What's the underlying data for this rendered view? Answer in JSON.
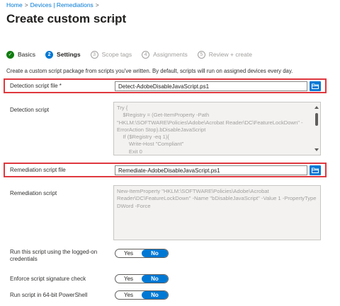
{
  "breadcrumb": {
    "items": [
      "Home",
      "Devices | Remediations"
    ]
  },
  "page": {
    "title": "Create custom script",
    "more": "···"
  },
  "wizard": {
    "steps": [
      {
        "num": "✓",
        "label": "Basics",
        "state": "done"
      },
      {
        "num": "2",
        "label": "Settings",
        "state": "active"
      },
      {
        "num": "3",
        "label": "Scope tags",
        "state": "pending"
      },
      {
        "num": "4",
        "label": "Assignments",
        "state": "pending"
      },
      {
        "num": "5",
        "label": "Review + create",
        "state": "pending"
      }
    ]
  },
  "description": "Create a custom script package from scripts you've written. By default, scripts will run on assigned devices every day.",
  "detection_file": {
    "label": "Detection script file *",
    "value": "Detect-AdobeDisableJavaScript.ps1"
  },
  "detection_script": {
    "label": "Detection script",
    "lines": [
      "Try {",
      "    $Registry = (Get-ItemProperty -Path",
      "\"HKLM:\\SOFTWARE\\Policies\\Adobe\\Acrobat Reader\\DC\\FeatureLockDown\" -",
      "ErrorAction Stop).bDisableJavaScript",
      "    If ($Registry -eq 1){",
      "        Write-Host \"Compliant\"",
      "        Exit 0"
    ]
  },
  "remediation_file": {
    "label": "Remediation script file",
    "value": "Remediate-AdobeDisableJavaScript.ps1"
  },
  "remediation_script": {
    "label": "Remediation script",
    "text": "New-ItemProperty \"HKLM:\\SOFTWARE\\Policies\\Adobe\\Acrobat Reader\\DC\\FeatureLockDown\" -Name \"bDisableJavaScript\" -Value 1 -PropertyType DWord -Force"
  },
  "options": [
    {
      "label": "Run this script using the logged-on credentials",
      "yes": "Yes",
      "no": "No",
      "selected": "No"
    },
    {
      "label": "Enforce script signature check",
      "yes": "Yes",
      "no": "No",
      "selected": "No"
    },
    {
      "label": "Run script in 64-bit PowerShell",
      "yes": "Yes",
      "no": "No",
      "selected": "No"
    }
  ],
  "colors": {
    "accent": "#0078d4",
    "highlight": "#e0383f",
    "success": "#107c10"
  },
  "icons": {
    "folder": "folder-open-icon"
  }
}
